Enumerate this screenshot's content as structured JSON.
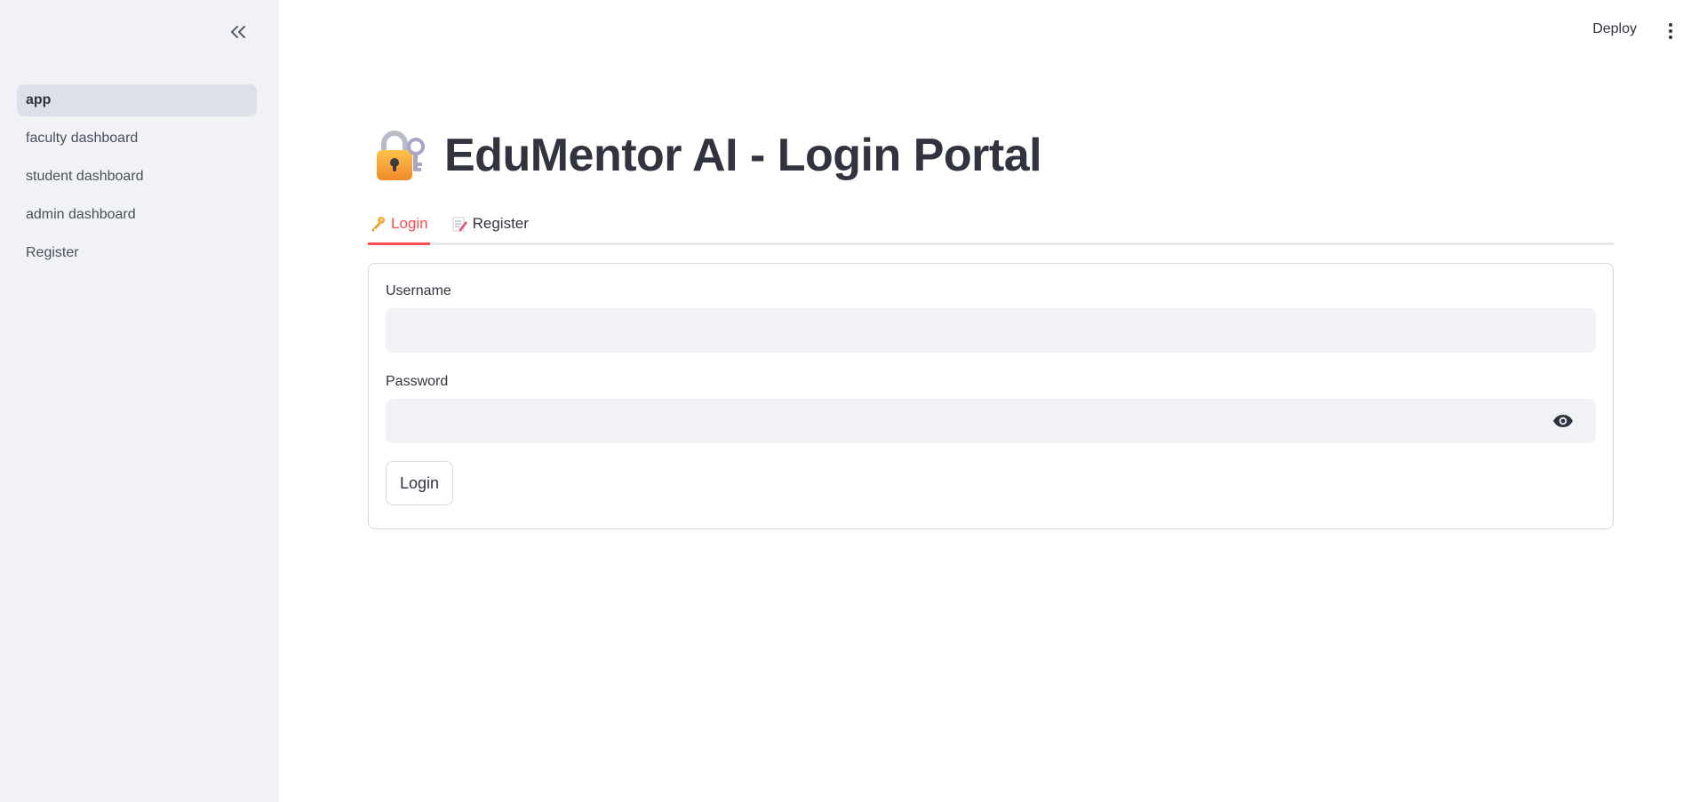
{
  "sidebar": {
    "items": [
      {
        "label": "app",
        "active": true
      },
      {
        "label": "faculty dashboard"
      },
      {
        "label": "student dashboard"
      },
      {
        "label": "admin dashboard"
      },
      {
        "label": "Register"
      }
    ],
    "collapse_icon": "double-chevron-left-icon"
  },
  "header": {
    "deploy_label": "Deploy",
    "menu_icon": "kebab-menu-icon"
  },
  "main": {
    "title": "EduMentor AI - Login Portal",
    "title_icon": "locked-with-key-icon",
    "tabs": [
      {
        "label": "Login",
        "icon": "key-icon",
        "active": true
      },
      {
        "label": "Register",
        "icon": "memo-icon"
      }
    ],
    "form": {
      "username_label": "Username",
      "username_value": "",
      "password_label": "Password",
      "password_value": "",
      "submit_label": "Login"
    }
  },
  "colors": {
    "accent": "#ff4b4b",
    "sidebar_bg": "#f0f2f6",
    "text": "#31333f"
  }
}
